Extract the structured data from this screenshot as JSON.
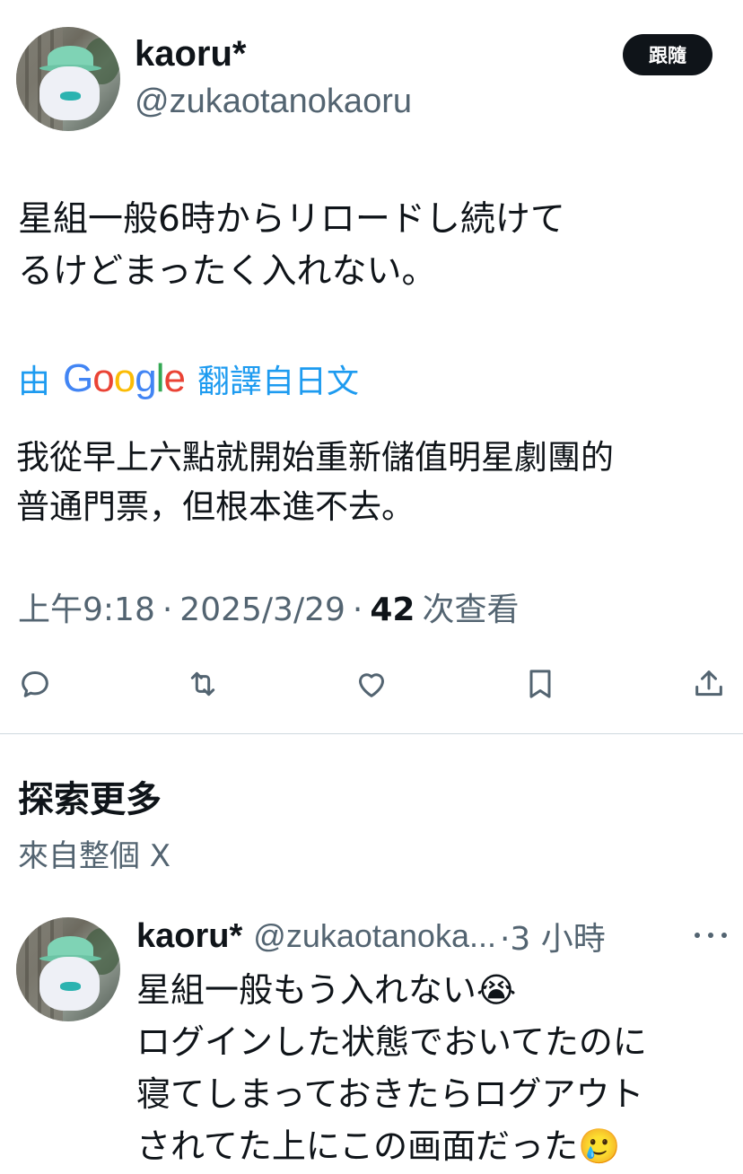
{
  "tweet": {
    "author_name": "kaoru*",
    "author_handle": "@zukaotanokaoru",
    "follow_label": "跟隨",
    "text": "星組一般6時からリロードし続けて\nるけどまったく入れない。",
    "translate": {
      "prefix": "由",
      "brand": "Google",
      "suffix": "翻譯自日文"
    },
    "translated_text": "我從早上六點就開始重新儲值明星劇團的\n普通門票，但根本進不去。",
    "time": "上午9:18",
    "date": "2025/3/29",
    "views_count": "42",
    "views_label": "次查看",
    "separator": "·"
  },
  "actions": [
    {
      "icon": "reply-icon"
    },
    {
      "icon": "retweet-icon"
    },
    {
      "icon": "like-icon"
    },
    {
      "icon": "bookmark-icon"
    },
    {
      "icon": "share-icon"
    }
  ],
  "explore": {
    "title": "探索更多",
    "subtitle": "來自整個 X"
  },
  "related": {
    "author_name": "kaoru*",
    "author_handle": "@zukaotanoka...",
    "time": "·3 小時",
    "text": "星組一般もう入れない😭\nログインした状態でおいてたのに\n寝てしまっておきたらログアウト\nされてた上にこの画面だった🥲"
  },
  "colors": {
    "text": "#0f1419",
    "secondary": "#536471",
    "link": "#1d9bf0",
    "divider": "#cfd9de"
  }
}
